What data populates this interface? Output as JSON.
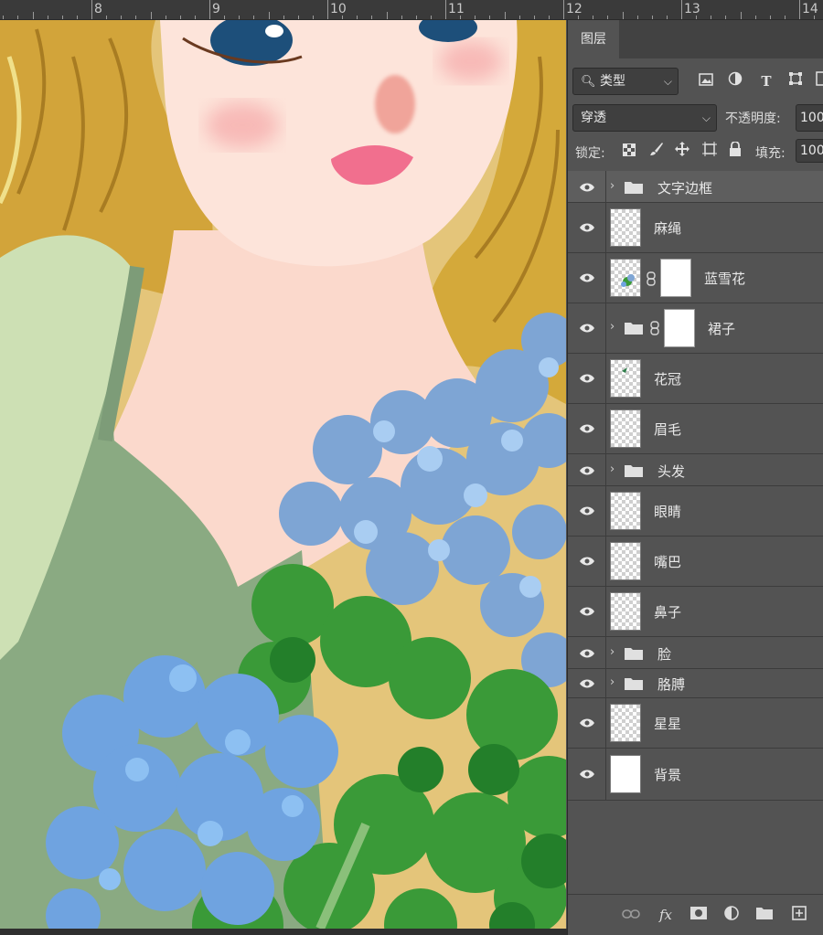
{
  "ruler": {
    "labels": [
      "8",
      "9",
      "10",
      "11",
      "12",
      "13",
      "14"
    ]
  },
  "panel": {
    "tab_label": "图层",
    "filter": {
      "value": "类型",
      "chevron": "⌵"
    },
    "blend": {
      "value": "穿透",
      "chevron": "⌵"
    },
    "opacity_label": "不透明度:",
    "opacity_value": "100",
    "lock_label": "锁定:",
    "fill_label": "填充:",
    "fill_value": "100",
    "filter_icons": [
      "image-filter-icon",
      "adjustment-filter-icon",
      "type-filter-icon",
      "shape-filter-icon",
      "smart-object-filter-icon"
    ],
    "lock_icons": [
      "lock-pixels-icon",
      "lock-paint-icon",
      "lock-move-icon",
      "lock-artboard-icon",
      "lock-all-icon"
    ],
    "layers": [
      {
        "name": "文字边框",
        "kind": "group",
        "selected": true
      },
      {
        "name": "麻绳",
        "kind": "layer",
        "thumb": "transparent"
      },
      {
        "name": "蓝雪花",
        "kind": "masked",
        "thumb": "flowers"
      },
      {
        "name": "裙子",
        "kind": "group-masked"
      },
      {
        "name": "花冠",
        "kind": "layer",
        "thumb": "crown"
      },
      {
        "name": "眉毛",
        "kind": "layer",
        "thumb": "transparent"
      },
      {
        "name": "头发",
        "kind": "group"
      },
      {
        "name": "眼睛",
        "kind": "layer",
        "thumb": "transparent"
      },
      {
        "name": "嘴巴",
        "kind": "layer",
        "thumb": "transparent"
      },
      {
        "name": "鼻子",
        "kind": "layer",
        "thumb": "transparent"
      },
      {
        "name": "脸",
        "kind": "group"
      },
      {
        "name": "胳膊",
        "kind": "group"
      },
      {
        "name": "星星",
        "kind": "layer",
        "thumb": "transparent"
      },
      {
        "name": "背景",
        "kind": "layer",
        "thumb": "white"
      }
    ],
    "bottom_icons": [
      "link-layers-icon",
      "fx-icon",
      "add-mask-icon",
      "adjustment-layer-icon",
      "new-group-icon",
      "new-layer-icon"
    ],
    "fx_label": "fx"
  },
  "colors": {
    "panel_bg": "#535353",
    "selected_row": "#5e5e5e",
    "hair": "#d4a93a",
    "skin": "#fde3d8",
    "dress": "#8fac85",
    "hydrangea": "#7fa6d6",
    "leaves": "#3c9a3a"
  }
}
